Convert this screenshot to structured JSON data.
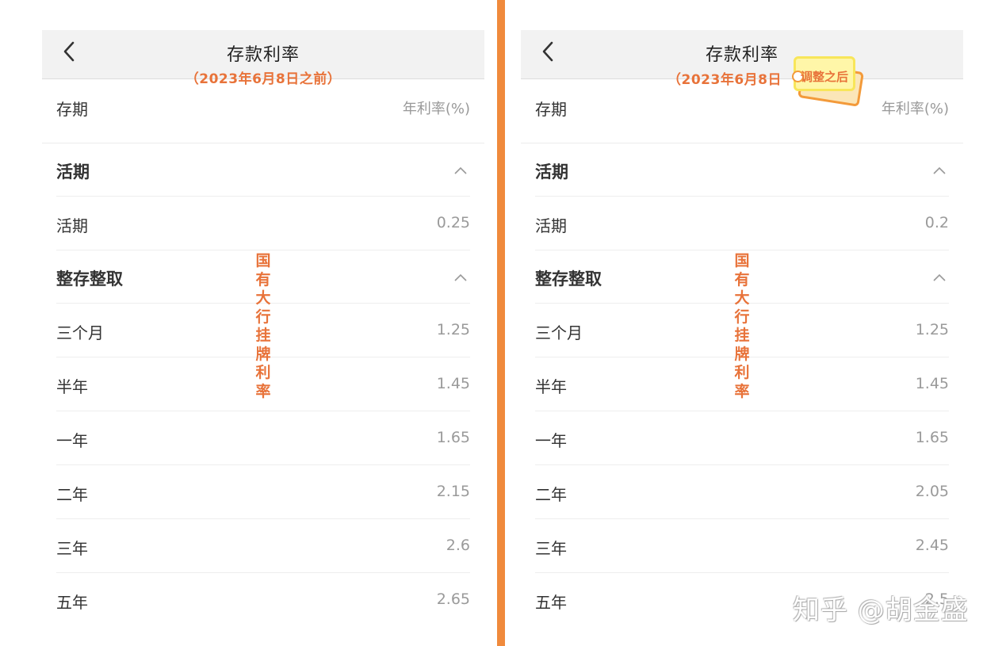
{
  "panels": {
    "left": {
      "nav": {
        "title": "存款利率",
        "note": "（2023年6月8日之前）"
      },
      "header": {
        "label": "存期",
        "value": "年利率(%)"
      },
      "sections": [
        {
          "title": "活期",
          "rows": [
            {
              "label": "活期",
              "value": "0.25"
            }
          ]
        },
        {
          "title": "整存整取",
          "rows": [
            {
              "label": "三个月",
              "value": "1.25"
            },
            {
              "label": "半年",
              "value": "1.45"
            },
            {
              "label": "一年",
              "value": "1.65"
            },
            {
              "label": "二年",
              "value": "2.15"
            },
            {
              "label": "三年",
              "value": "2.6"
            },
            {
              "label": "五年",
              "value": "2.65"
            }
          ]
        }
      ],
      "side_note": "国有大行挂牌利率"
    },
    "right": {
      "nav": {
        "title": "存款利率",
        "note": "（2023年6月8日",
        "tag": "调整之后"
      },
      "header": {
        "label": "存期",
        "value": "年利率(%)"
      },
      "sections": [
        {
          "title": "活期",
          "rows": [
            {
              "label": "活期",
              "value": "0.2"
            }
          ]
        },
        {
          "title": "整存整取",
          "rows": [
            {
              "label": "三个月",
              "value": "1.25"
            },
            {
              "label": "半年",
              "value": "1.45"
            },
            {
              "label": "一年",
              "value": "1.65"
            },
            {
              "label": "二年",
              "value": "2.05"
            },
            {
              "label": "三年",
              "value": "2.45"
            },
            {
              "label": "五年",
              "value": "2.5"
            }
          ]
        }
      ],
      "side_note": "国有大行挂牌利率"
    }
  },
  "watermark": "知乎 @胡金盛",
  "colors": {
    "accent": "#e8733a",
    "divider": "#f08a3c",
    "nav_bg": "#f2f2f2",
    "tag_fill": "#fff6a8"
  },
  "icons": {
    "back": "chevron-left-icon",
    "collapse": "chevron-up-icon"
  }
}
